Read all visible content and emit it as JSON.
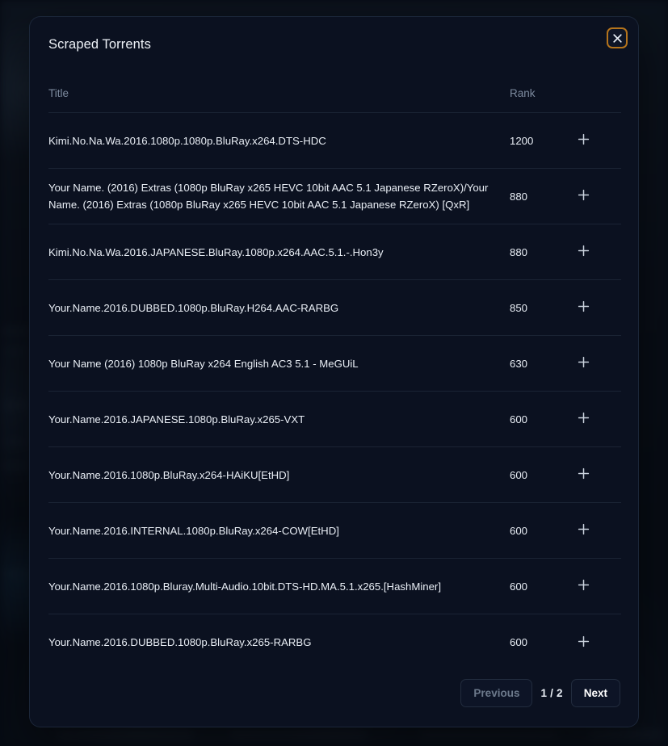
{
  "modal": {
    "title": "Scraped Torrents",
    "close_icon": "close-icon"
  },
  "table": {
    "columns": {
      "title": "Title",
      "rank": "Rank",
      "action": ""
    },
    "add_icon": "plus-icon",
    "rows": [
      {
        "title": "Kimi.No.Na.Wa.2016.1080p.1080p.BluRay.x264.DTS-HDC",
        "rank": "1200"
      },
      {
        "title": "Your Name. (2016) Extras (1080p BluRay x265 HEVC 10bit AAC 5.1 Japanese RZeroX)/Your Name. (2016) Extras (1080p BluRay x265 HEVC 10bit AAC 5.1 Japanese RZeroX) [QxR]",
        "rank": "880"
      },
      {
        "title": "Kimi.No.Na.Wa.2016.JAPANESE.BluRay.1080p.x264.AAC.5.1.-.Hon3y",
        "rank": "880"
      },
      {
        "title": "Your.Name.2016.DUBBED.1080p.BluRay.H264.AAC-RARBG",
        "rank": "850"
      },
      {
        "title": "Your Name (2016) 1080p BluRay x264 English AC3 5.1 - MeGUiL",
        "rank": "630"
      },
      {
        "title": "Your.Name.2016.JAPANESE.1080p.BluRay.x265-VXT",
        "rank": "600"
      },
      {
        "title": "Your.Name.2016.1080p.BluRay.x264-HAiKU[EtHD]",
        "rank": "600"
      },
      {
        "title": "Your.Name.2016.INTERNAL.1080p.BluRay.x264-COW[EtHD]",
        "rank": "600"
      },
      {
        "title": "Your.Name.2016.1080p.Bluray.Multi-Audio.10bit.DTS-HD.MA.5.1.x265.[HashMiner]",
        "rank": "600"
      },
      {
        "title": "Your.Name.2016.DUBBED.1080p.BluRay.x265-RARBG",
        "rank": "600"
      }
    ]
  },
  "pagination": {
    "previous_label": "Previous",
    "next_label": "Next",
    "indicator": "1 / 2",
    "current_page": 1,
    "total_pages": 2
  },
  "colors": {
    "modal_background": "#0b1120",
    "page_background": "#0a0f19",
    "close_border": "#b5741c",
    "divider": "#1b2434",
    "text_primary": "#e9eef5",
    "text_muted": "#7c8a9e"
  }
}
